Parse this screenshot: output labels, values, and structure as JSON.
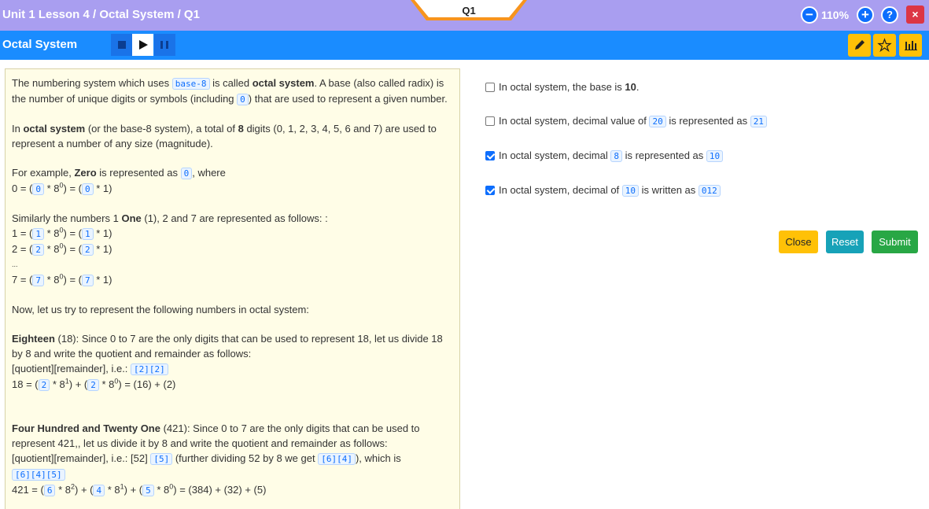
{
  "header": {
    "breadcrumb": "Unit 1 Lesson 4 / Octal System / Q1",
    "question_tab": "Q1",
    "zoom": "110%",
    "zoom_out_icon": "−",
    "zoom_in_icon": "+",
    "help_icon": "?",
    "close_icon": "×"
  },
  "subheader": {
    "title": "Octal System",
    "player": [
      "stop-icon",
      "play-icon",
      "pause-icon"
    ],
    "tools": [
      "pencil-icon",
      "star-icon",
      "bar-chart-icon"
    ]
  },
  "lesson": {
    "p1": {
      "a": "The numbering system which uses ",
      "code1": "base-8",
      "b": " is called ",
      "bold1": "octal system",
      "c": ". A base (also called radix) is the number of unique digits or symbols (including ",
      "code2": "0",
      "d": ") that are used to represent a given number."
    },
    "p2": {
      "a": "In ",
      "bold1": "octal system",
      "b": " (or the base-8 system), a total of ",
      "bold2": "8",
      "c": " digits (0, 1, 2, 3, 4, 5, 6 and 7) are used to represent a number of any size (magnitude)."
    },
    "p3": {
      "a": "For example, ",
      "bold1": "Zero",
      "b": " is represented as ",
      "code1": "0",
      "c": ", where"
    },
    "eq0": {
      "a": "0 = (",
      "code1": "0",
      "b": " * 8",
      "sup": "0",
      "c": ") = (",
      "code2": "0",
      "d": " * 1)"
    },
    "p4": {
      "a": "Similarly the numbers 1 ",
      "bold1": "One",
      "b": " (1), 2 and 7 are represented as follows: :"
    },
    "eq1": {
      "a": "1 = (",
      "code1": "1",
      "b": " * 8",
      "sup": "0",
      "c": ") = (",
      "code2": "1",
      "d": " * 1)"
    },
    "eq2": {
      "a": "2 = (",
      "code1": "2",
      "b": " * 8",
      "sup": "0",
      "c": ") = (",
      "code2": "2",
      "d": " * 1)"
    },
    "ellipsis": "...",
    "eq7": {
      "a": "7 = (",
      "code1": "7",
      "b": " * 8",
      "sup": "0",
      "c": ") = (",
      "code2": "7",
      "d": " * 1)"
    },
    "p5": "Now, let us try to represent the following numbers in octal system:",
    "p6": {
      "bold1": "Eighteen",
      "a": " (18): Since 0 to 7 are the only digits that can be used to represent 18, let us divide 18 by 8 and write the quotient and remainder as follows:"
    },
    "p7": {
      "a": "[quotient][remainder], i.e.: ",
      "code1": "[2][2]"
    },
    "eq18": {
      "a": "18 = (",
      "code1": "2",
      "b": " * 8",
      "sup1": "1",
      "c": ") + (",
      "code2": "2",
      "d": " * 8",
      "sup2": "0",
      "e": ") = (16) + (2)"
    },
    "p8": {
      "bold1": "Four Hundred and Twenty One",
      "a": " (421): Since 0 to 7 are the only digits that can be used to represent 421,, let us divide it by 8 and write the quotient and remainder as follows:"
    },
    "p9": {
      "a": "[quotient][remainder], i.e.: [52] ",
      "code1": "[5]",
      "b": " (further dividing 52 by 8 we get ",
      "code2": "[6][4]",
      "c": "), which is"
    },
    "p10": {
      "code1": "[6][4][5]"
    },
    "eq421": {
      "a": "421 = (",
      "code1": "6",
      "b": " * 8",
      "sup1": "2",
      "c": ") + (",
      "code2": "4",
      "d": " * 8",
      "sup2": "1",
      "e": ") + (",
      "code3": "5",
      "f": " * 8",
      "sup3": "0",
      "g": ") = (384) + (32) + (5)"
    }
  },
  "questions": [
    {
      "checked": false,
      "a": "In octal system, the base is ",
      "bold": "10",
      "b": "."
    },
    {
      "checked": false,
      "a": "In octal system, decimal value of ",
      "code1": "20",
      "b": " is represented as ",
      "code2": "21"
    },
    {
      "checked": true,
      "a": "In octal system, decimal ",
      "code1": "8",
      "b": " is represented as ",
      "code2": "10"
    },
    {
      "checked": true,
      "a": "In octal system, decimal of ",
      "code1": "10",
      "b": " is written as ",
      "code2": "012"
    }
  ],
  "buttons": {
    "close": "Close",
    "reset": "Reset",
    "submit": "Submit"
  },
  "colors": {
    "header": "#a99ef0",
    "subheader": "#1a8cff",
    "panel": "#fffde7",
    "code": "#0d6efd",
    "close": "#ffc107",
    "reset": "#17a2b8",
    "submit": "#28a745",
    "exit": "#dc3545"
  }
}
